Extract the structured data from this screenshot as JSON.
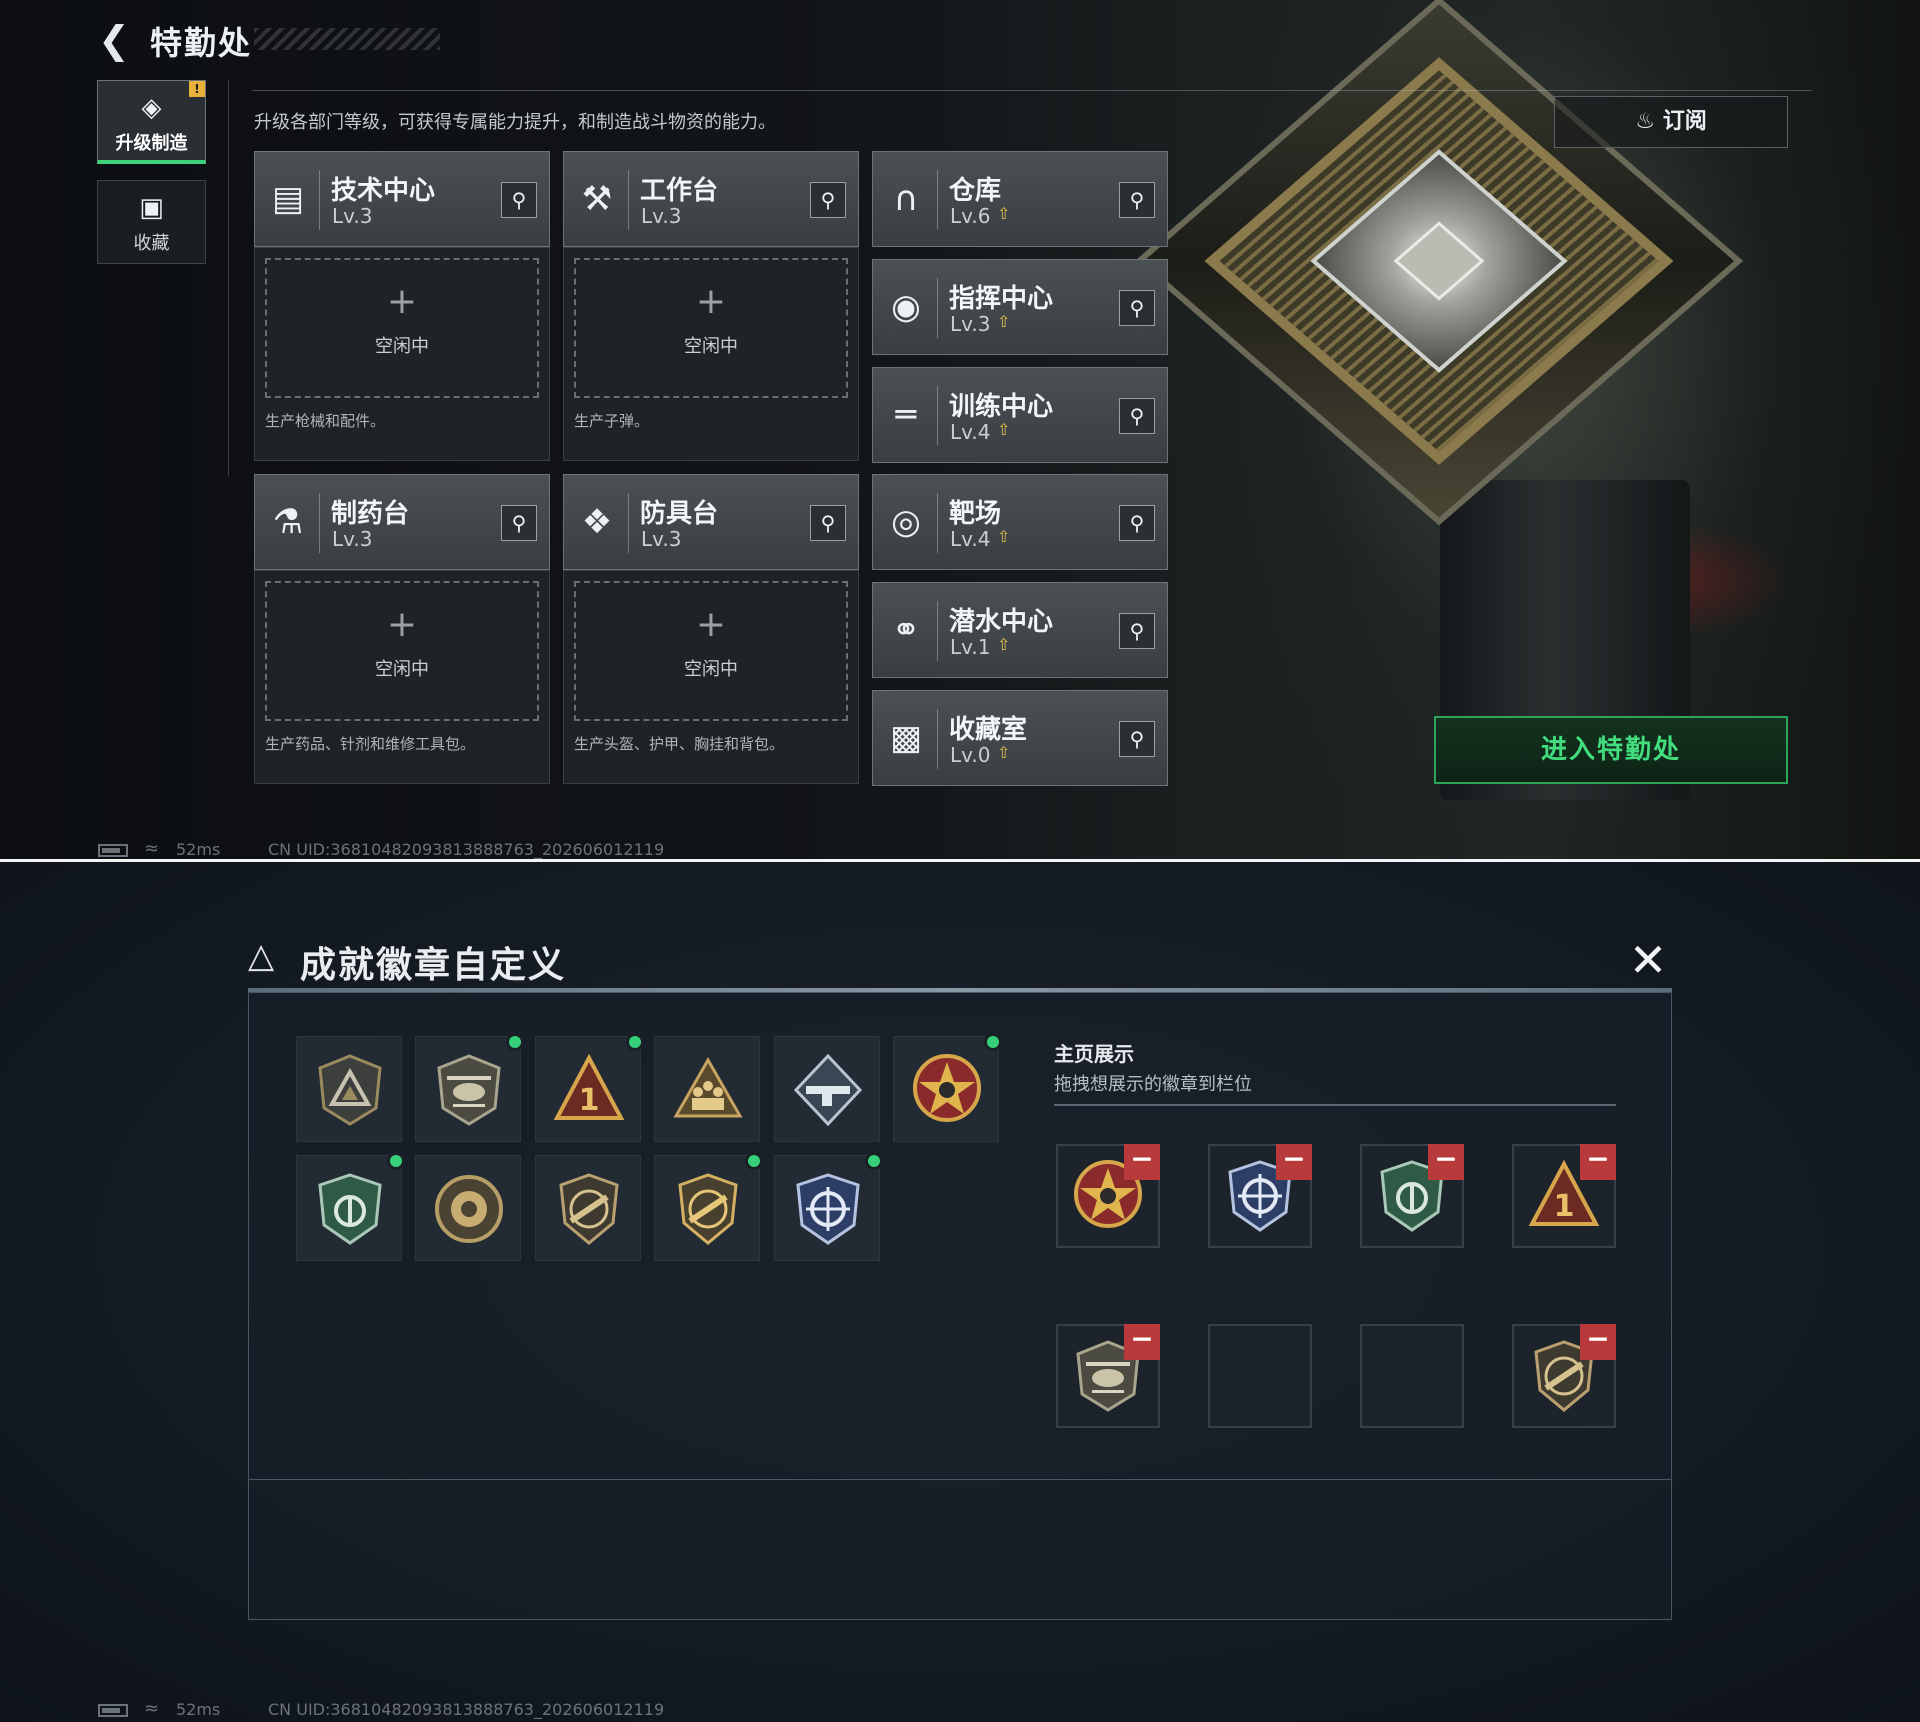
{
  "top": {
    "title": "特勤处",
    "hint": "升级各部门等级，可获得专属能力提升，和制造战斗物资的能力。",
    "side_tabs": [
      {
        "label": "升级制造",
        "icon": "upgrade-icon",
        "active": true,
        "warn": "!"
      },
      {
        "label": "收藏",
        "icon": "collection-icon",
        "active": false
      }
    ],
    "departments": [
      {
        "name": "技术中心",
        "level": "Lv.3",
        "icon": "tech-center-icon",
        "upgrade": false
      },
      {
        "name": "工作台",
        "level": "Lv.3",
        "icon": "workbench-icon",
        "upgrade": false
      },
      {
        "name": "仓库",
        "level": "Lv.6",
        "icon": "warehouse-icon",
        "upgrade": true
      },
      {
        "name": "指挥中心",
        "level": "Lv.3",
        "icon": "command-center-icon",
        "upgrade": true
      },
      {
        "name": "训练中心",
        "level": "Lv.4",
        "icon": "training-center-icon",
        "upgrade": true
      },
      {
        "name": "制药台",
        "level": "Lv.3",
        "icon": "pharmacy-icon",
        "upgrade": false
      },
      {
        "name": "防具台",
        "level": "Lv.3",
        "icon": "armor-bench-icon",
        "upgrade": false
      },
      {
        "name": "靶场",
        "level": "Lv.4",
        "icon": "shooting-range-icon",
        "upgrade": true
      },
      {
        "name": "潜水中心",
        "level": "Lv.1",
        "icon": "diving-center-icon",
        "upgrade": true
      },
      {
        "name": "收藏室",
        "level": "Lv.0",
        "icon": "collection-room-icon",
        "upgrade": true
      }
    ],
    "slots": [
      {
        "plus": "+",
        "status": "空闲中",
        "desc": "生产枪械和配件。"
      },
      {
        "plus": "+",
        "status": "空闲中",
        "desc": "生产子弹。"
      },
      {
        "plus": "+",
        "status": "空闲中",
        "desc": "生产药品、针剂和维修工具包。"
      },
      {
        "plus": "+",
        "status": "空闲中",
        "desc": "生产头盔、护甲、胸挂和背包。"
      }
    ],
    "subscribe_label": "订阅",
    "enter_label": "进入特勤处",
    "status": {
      "ping": "52ms",
      "uid": "CN UID:3681048209381388876​3_202606012119"
    }
  },
  "bottom": {
    "title": "成就徽章自定义",
    "close_icon": "close-icon",
    "home_title": "主页展示",
    "home_subtitle": "拖拽想展示的徽章到栏位",
    "badges": [
      {
        "icon": "triangle-shield-badge-icon",
        "new": false
      },
      {
        "icon": "helicopter-badge-icon",
        "new": true
      },
      {
        "icon": "number-one-triangle-badge-icon",
        "new": true
      },
      {
        "icon": "squad-triangle-badge-icon",
        "new": false
      },
      {
        "icon": "diamond-rifle-badge-icon",
        "new": false
      },
      {
        "icon": "star-skull-medal-badge-icon",
        "new": true
      },
      {
        "icon": "green-shield-badge-icon",
        "new": true
      },
      {
        "icon": "round-emblem-badge-icon",
        "new": false
      },
      {
        "icon": "rifle-shield-badge-icon",
        "new": false
      },
      {
        "icon": "rifle-shield-gold-badge-icon",
        "new": true
      },
      {
        "icon": "crosshair-blue-badge-icon",
        "new": true
      }
    ],
    "showcase": [
      {
        "icon": "star-skull-medal-badge-icon",
        "filled": true,
        "remove": "−"
      },
      {
        "icon": "crosshair-blue-badge-icon",
        "filled": true,
        "remove": "−"
      },
      {
        "icon": "green-shield-badge-icon",
        "filled": true,
        "remove": "−"
      },
      {
        "icon": "number-one-triangle-badge-icon",
        "filled": true,
        "remove": "−"
      },
      {
        "icon": "helicopter-badge-icon",
        "filled": true,
        "remove": "−"
      },
      {
        "icon": "empty-slot",
        "filled": false
      },
      {
        "icon": "empty-slot",
        "filled": false
      },
      {
        "icon": "rifle-shield-badge-icon",
        "filled": true,
        "remove": "−"
      }
    ],
    "status": {
      "ping": "52ms",
      "uid": "CN UID:3681048209381388876​3_202606012119"
    }
  },
  "colors": {
    "accent_green": "#3ed37a",
    "enter_green": "#42de7d",
    "upgrade_gold": "#e2c24c",
    "remove_red": "#b83a3a"
  }
}
